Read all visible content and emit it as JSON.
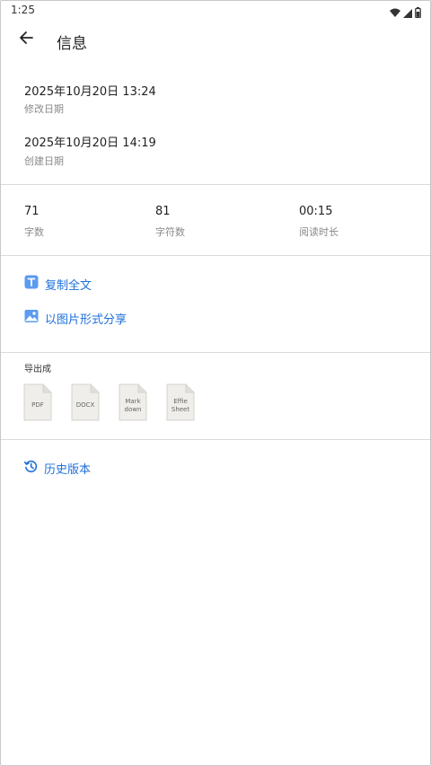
{
  "status_bar": {
    "time": "1:25",
    "icons": [
      "wifi-icon",
      "signal-icon",
      "battery-icon"
    ]
  },
  "header": {
    "title": "信息",
    "back_icon": "arrow-left-icon"
  },
  "dates": {
    "modified": {
      "value": "2025年10月20日 13:24",
      "label": "修改日期"
    },
    "created": {
      "value": "2025年10月20日 14:19",
      "label": "创建日期"
    }
  },
  "stats": [
    {
      "value": "71",
      "label": "字数"
    },
    {
      "value": "81",
      "label": "字符数"
    },
    {
      "value": "00:15",
      "label": "阅读时长"
    }
  ],
  "actions": {
    "copy_all": {
      "label": "复制全文",
      "icon": "text-copy-icon"
    },
    "share_image": {
      "label": "以图片形式分享",
      "icon": "image-icon"
    }
  },
  "export": {
    "title": "导出成",
    "formats": [
      {
        "name": "PDF",
        "lines": [
          "PDF"
        ]
      },
      {
        "name": "DOCX",
        "lines": [
          "DOCX"
        ]
      },
      {
        "name": "Markdown",
        "lines": [
          "Mark",
          "down"
        ]
      },
      {
        "name": "Effie Sheet",
        "lines": [
          "Effie",
          "Sheet"
        ]
      }
    ]
  },
  "history": {
    "label": "历史版本",
    "icon": "history-icon"
  },
  "colors": {
    "accent": "#1e6fd9",
    "icon_blue": "#5b9bf0",
    "divider": "#dadada",
    "secondary_text": "#8a8a8a",
    "file_fill": "#efeeea"
  }
}
